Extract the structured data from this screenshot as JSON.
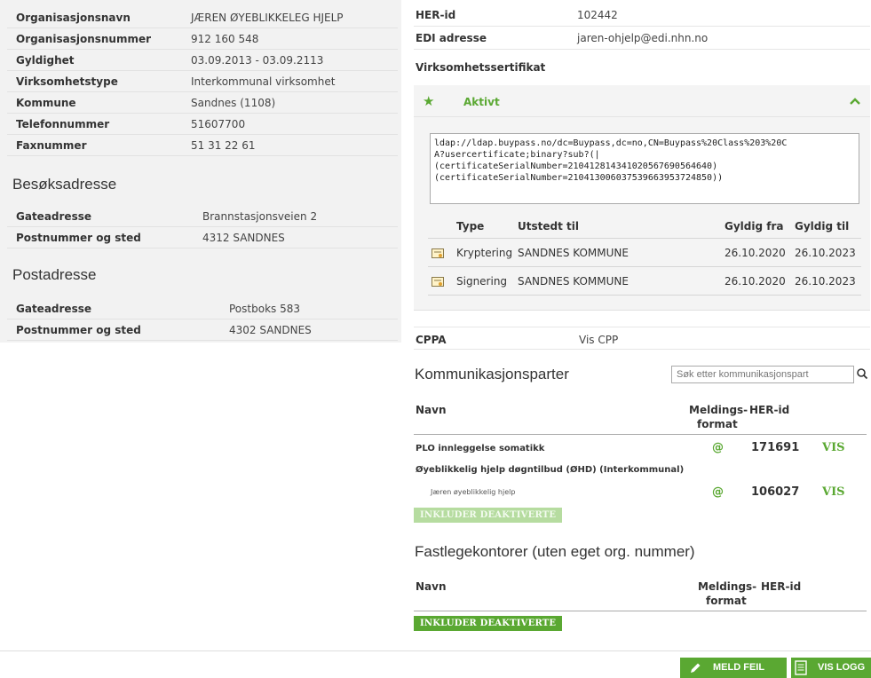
{
  "org": {
    "rows": [
      {
        "label": "Organisasjonsnavn",
        "value": "JÆREN ØYEBLIKKELEG HJELP"
      },
      {
        "label": "Organisasjonsnummer",
        "value": "912 160 548"
      },
      {
        "label": "Gyldighet",
        "value": "03.09.2013 - 03.09.2113"
      },
      {
        "label": "Virksomhetstype",
        "value": "Interkommunal virksomhet"
      },
      {
        "label": "Kommune",
        "value": "Sandnes (1108)"
      },
      {
        "label": "Telefonnummer",
        "value": "51607700"
      },
      {
        "label": "Faxnummer",
        "value": "51 31 22 61"
      }
    ]
  },
  "visit": {
    "title": "Besøksadresse",
    "rows": [
      {
        "label": "Gateadresse",
        "value": "Brannstasjonsveien 2"
      },
      {
        "label": "Postnummer og sted",
        "value": "4312 SANDNES"
      }
    ]
  },
  "post": {
    "title": "Postadresse",
    "rows": [
      {
        "label": "Gateadresse",
        "value": "Postboks 583"
      },
      {
        "label": "Postnummer og sted",
        "value": "4302 SANDNES"
      }
    ]
  },
  "ids": {
    "her_label": "HER-id",
    "her_value": "102442",
    "edi_label": "EDI adresse",
    "edi_value": "jaren-ohjelp@edi.nhn.no"
  },
  "certificate": {
    "title": "Virksomhetssertifikat",
    "status": "Aktivt",
    "ldap": "ldap://ldap.buypass.no/dc=Buypass,dc=no,CN=Buypass%20Class%203%20C\nA?usercertificate;binary?sub?(|\n(certificateSerialNumber=210412814341020567690564640)\n(certificateSerialNumber=210413006037539663953724850))",
    "columns": [
      "Type",
      "Utstedt til",
      "Gyldig fra",
      "Gyldig til"
    ],
    "rows": [
      {
        "type": "Kryptering",
        "issued_to": "SANDNES KOMMUNE",
        "from": "26.10.2020",
        "to": "26.10.2023"
      },
      {
        "type": "Signering",
        "issued_to": "SANDNES KOMMUNE",
        "from": "26.10.2020",
        "to": "26.10.2023"
      }
    ]
  },
  "cppa": {
    "label": "CPPA",
    "link": "Vis CPP"
  },
  "komm": {
    "title": "Kommunikasjonsparter",
    "search_placeholder": "Søk etter kommunikasjonspart",
    "col_name": "Navn",
    "col_format_1": "Meldings-",
    "col_format_2": "format",
    "col_her": "HER-id",
    "entries": [
      {
        "name": "PLO innleggelse somatikk",
        "format": "@",
        "her": "171691",
        "action": "VIS"
      }
    ],
    "group": "Øyeblikkelig hjelp døgntilbud (ØHD) (Interkommunal)",
    "group_entries": [
      {
        "name": "Jæren øyeblikkelig hjelp",
        "format": "@",
        "her": "106027",
        "action": "VIS"
      }
    ],
    "include_label": "INKLUDER DEAKTIVERTE"
  },
  "fastlege": {
    "title": "Fastlegekontorer (uten eget org. nummer)",
    "col_name": "Navn",
    "col_format_1": "Meldings-",
    "col_format_2": "format",
    "col_her": "HER-id",
    "include_label": "INKLUDER DEAKTIVERTE"
  },
  "footer": {
    "report_label": "MELD FEIL",
    "log_label": "VIS LOGG"
  },
  "colors": {
    "accent": "#5aa832",
    "panel": "#f2f2f2"
  }
}
